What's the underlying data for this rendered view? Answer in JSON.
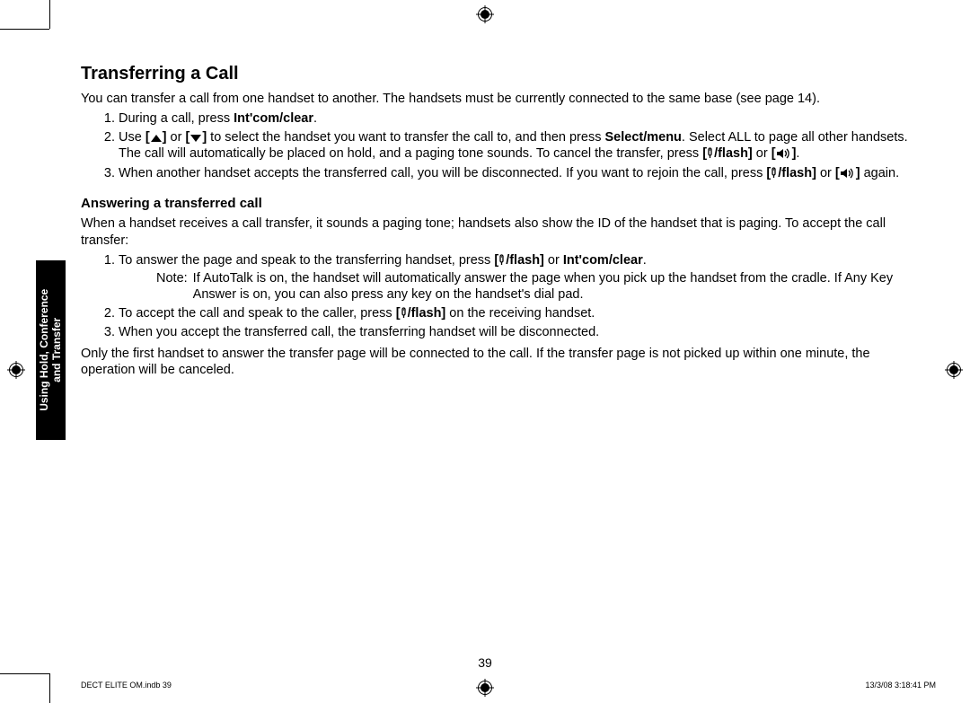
{
  "heading": "Transferring a Call",
  "intro": "You can transfer a call from one handset to another. The handsets must be currently connected to the same base (see page 14).",
  "list1": {
    "i1_a": "During a call, press ",
    "i1_b": "Int'com/clear",
    "i1_c": ".",
    "i2_a": "Use ",
    "i2_b": " or ",
    "i2_c": " to select the handset you want to transfer the call to, and then press ",
    "i2_d": "Select/menu",
    "i2_e": ". Select ALL to page all other handsets. The call will automatically be placed on hold, and a paging tone sounds. To cancel the transfer, press ",
    "i2_f": "/flash]",
    "i2_g": " or ",
    "i2_h": ".",
    "i3_a": "When another handset accepts the transferred call, you will be disconnected. If you want to rejoin the call, press ",
    "i3_b": "/flash]",
    "i3_c": " or ",
    "i3_d": " again."
  },
  "subheading": "Answering a transferred call",
  "p2": "When a handset receives a call transfer, it sounds a paging tone; handsets also show the ID of the handset that is paging. To accept the call transfer:",
  "list2": {
    "i1_a": "To answer the page and speak to the transferring handset, press ",
    "i1_b": "/flash]",
    "i1_c": " or ",
    "i1_d": "Int'com/clear",
    "i1_e": ".",
    "note_label": "Note:",
    "note_body": "If AutoTalk is on, the handset will automatically answer the page when you pick up the handset from the cradle. If Any Key Answer is on, you can also press any key on the handset's dial pad.",
    "i2_a": "To accept the call and speak to the caller, press ",
    "i2_b": "/flash]",
    "i2_c": " on the receiving handset.",
    "i3": "When you accept the transferred call, the transferring handset will be disconnected."
  },
  "p3": "Only the first handset to answer the transfer page will be connected to the call. If the transfer page is not picked up within one minute, the operation will be canceled.",
  "side_tab": "Using Hold, Conference\nand Transfer",
  "page_number": "39",
  "footer_left": "DECT ELITE OM.indb   39",
  "footer_right": "13/3/08   3:18:41 PM"
}
